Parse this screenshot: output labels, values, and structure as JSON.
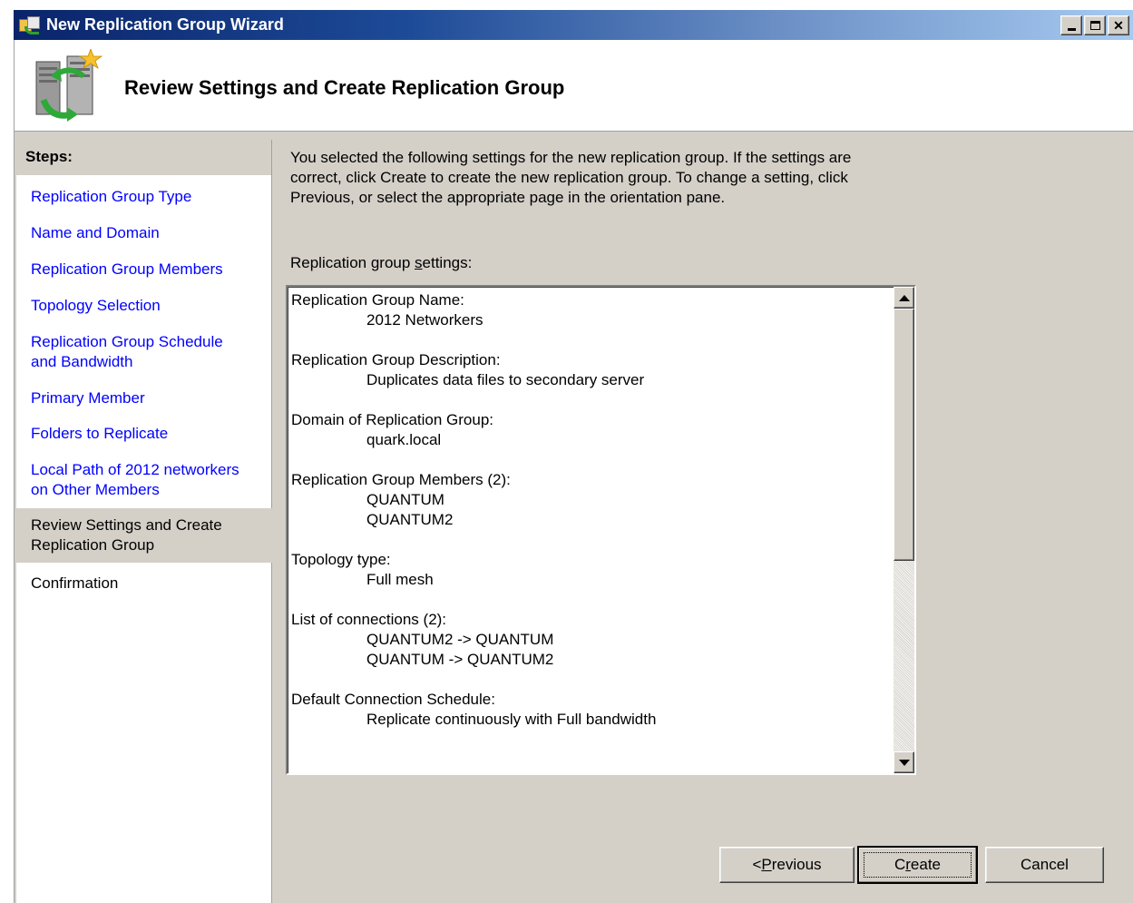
{
  "window": {
    "title": "New Replication Group Wizard",
    "controls": [
      "minimize",
      "maximize",
      "close"
    ]
  },
  "header": {
    "title": "Review Settings and Create Replication Group"
  },
  "steps": {
    "heading": "Steps:",
    "items": [
      {
        "label": "Replication Group Type",
        "state": "link"
      },
      {
        "label": "Name and Domain",
        "state": "link"
      },
      {
        "label": "Replication Group Members",
        "state": "link"
      },
      {
        "label": "Topology Selection",
        "state": "link"
      },
      {
        "label_line1": "Replication Group Schedule",
        "label_line2": "and Bandwidth",
        "state": "link"
      },
      {
        "label": "Primary Member",
        "state": "link"
      },
      {
        "label": "Folders to Replicate",
        "state": "link"
      },
      {
        "label_line1": "Local Path of 2012 networkers",
        "label_line2": "on Other Members",
        "state": "link"
      },
      {
        "label_line1": "Review Settings and Create",
        "label_line2": "Replication Group",
        "state": "current"
      },
      {
        "label": "Confirmation",
        "state": "upcoming"
      }
    ]
  },
  "main": {
    "intro_line1": "You selected the following settings for the new replication group. If the settings are",
    "intro_line2": "correct, click Create to create the new replication group. To change a setting, click",
    "intro_line3": "Previous, or select the appropriate page in the orientation pane.",
    "settings_label_pre": "Replication group ",
    "settings_label_accel": "s",
    "settings_label_post": "ettings:",
    "settings": [
      {
        "heading": "Replication Group Name:",
        "values": [
          "2012 Networkers"
        ]
      },
      {
        "heading": "Replication Group Description:",
        "values": [
          "Duplicates data files to secondary server"
        ]
      },
      {
        "heading": "Domain of Replication Group:",
        "values": [
          "quark.local"
        ]
      },
      {
        "heading": "Replication Group Members (2):",
        "values": [
          "QUANTUM",
          "QUANTUM2"
        ]
      },
      {
        "heading": "Topology type:",
        "values": [
          "Full mesh"
        ]
      },
      {
        "heading": "List of connections (2):",
        "values": [
          "QUANTUM2 -> QUANTUM",
          "QUANTUM -> QUANTUM2"
        ]
      },
      {
        "heading": "Default Connection Schedule:",
        "values": [
          "Replicate continuously with Full bandwidth"
        ]
      }
    ]
  },
  "buttons": {
    "previous_pre": "< ",
    "previous_accel": "P",
    "previous_post": "revious",
    "create_pre": "C",
    "create_accel": "r",
    "create_post": "eate",
    "cancel": "Cancel"
  },
  "colors": {
    "link": "#0000ff",
    "dialog_face": "#d4d0c8",
    "titlebar_start": "#0a246a",
    "titlebar_end": "#a6caf0"
  }
}
